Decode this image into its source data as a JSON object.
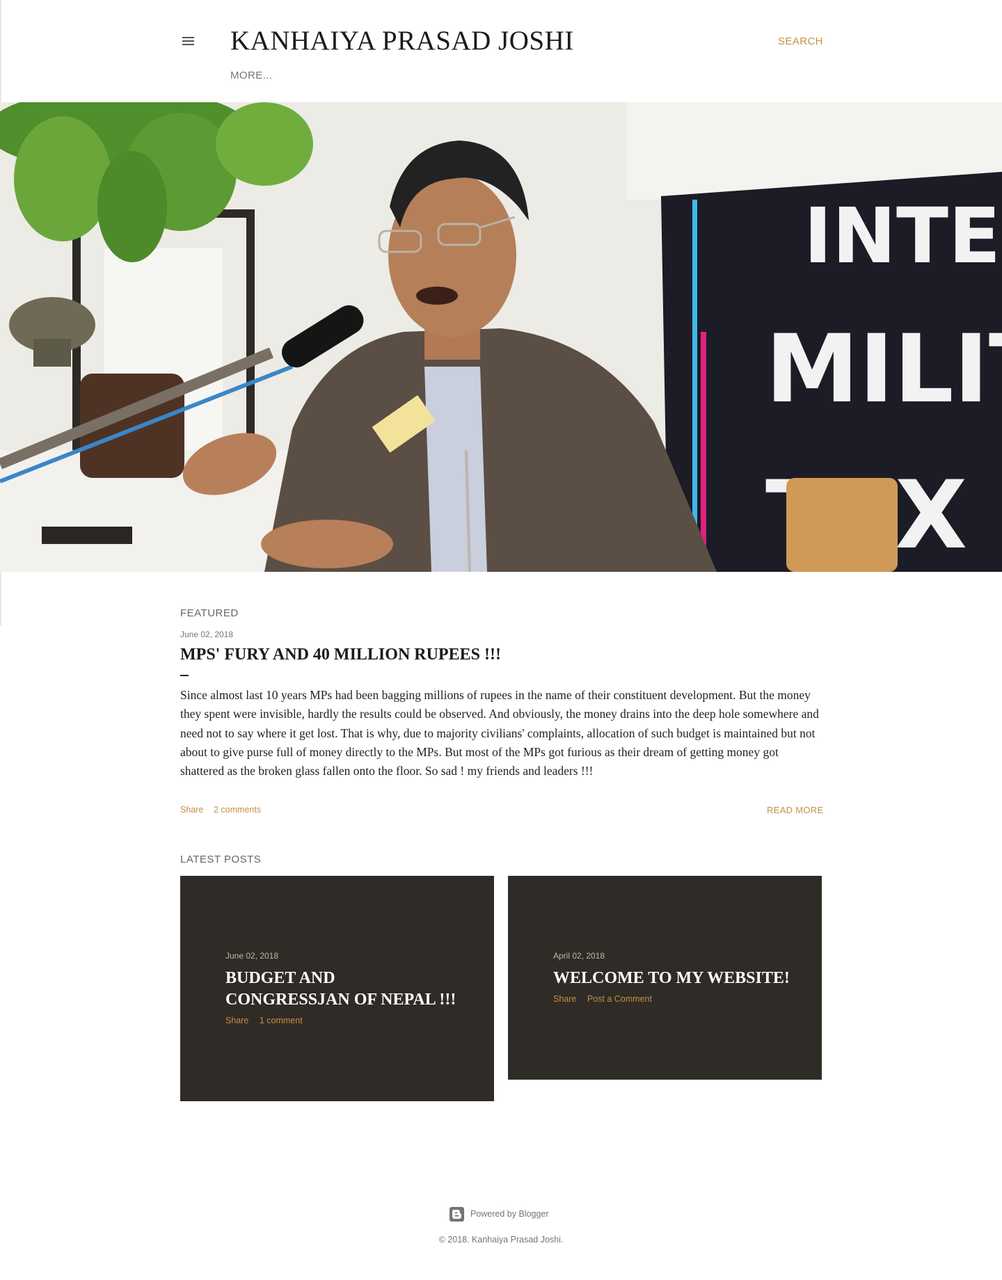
{
  "header": {
    "title": "KANHAIYA PRASAD JOSHI",
    "search_label": "SEARCH",
    "more_label": "MORE..."
  },
  "hero": {
    "image": "photo-of-speaker-at-microphone",
    "banner_text": [
      "INTERI",
      "MILIT",
      "TAX"
    ]
  },
  "featured": {
    "section_title": "FEATURED",
    "date": "June 02, 2018",
    "title": "MPS' FURY AND 40 MILLION RUPEES !!!",
    "snippet": "Since almost last 10 years MPs had been bagging millions of rupees in the name of their constituent development. But the money they spent were invisible, hardly the results could be observed. And obviously, the money drains into the deep hole somewhere and need not to say where it get lost. That is why, due to majority civilians' complaints, allocation of such budget is maintained but not about to give purse full of money directly to the  MPs. But most of the MPs got furious as their dream of getting money got shattered as the broken glass fallen onto the floor. So sad ! my friends and leaders !!!",
    "share_label": "Share",
    "comments_label": "2 comments",
    "read_more_label": "READ MORE"
  },
  "latest": {
    "section_title": "LATEST POSTS",
    "posts": [
      {
        "date": "June 02, 2018",
        "title": "BUDGET AND CONGRESSJAN OF NEPAL !!!",
        "share_label": "Share",
        "comments_label": "1 comment"
      },
      {
        "date": "April 02, 2018",
        "title": "WELCOME TO MY WEBSITE!",
        "share_label": "Share",
        "comments_label": "Post a Comment"
      }
    ]
  },
  "footer": {
    "powered_label": "Powered by Blogger",
    "copyright": "© 2018. Kanhaiya Prasad Joshi."
  },
  "colors": {
    "accent": "#c49044",
    "card_background": "#2f2b26",
    "text": "#222222",
    "muted": "#757575"
  }
}
